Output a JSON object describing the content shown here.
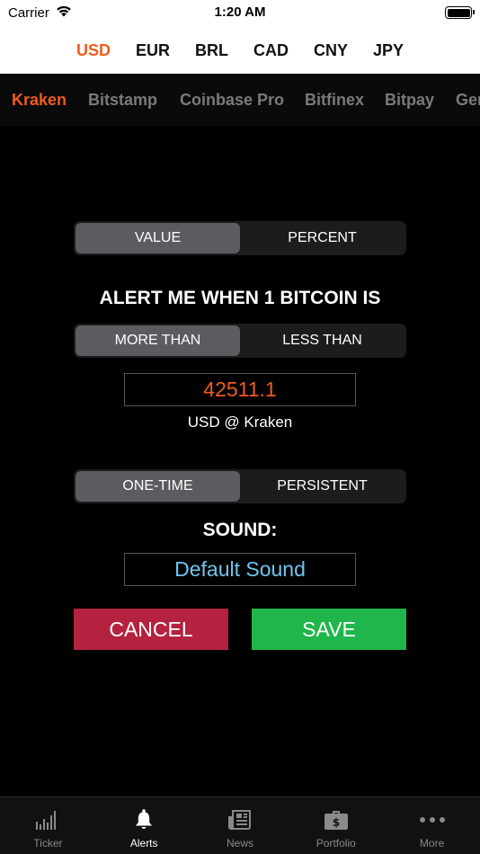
{
  "status_bar": {
    "carrier": "Carrier",
    "time": "1:20 AM"
  },
  "currencies": [
    {
      "label": "USD",
      "active": true
    },
    {
      "label": "EUR",
      "active": false
    },
    {
      "label": "BRL",
      "active": false
    },
    {
      "label": "CAD",
      "active": false
    },
    {
      "label": "CNY",
      "active": false
    },
    {
      "label": "JPY",
      "active": false
    }
  ],
  "exchanges": [
    {
      "label": "Kraken",
      "active": true
    },
    {
      "label": "Bitstamp",
      "active": false
    },
    {
      "label": "Coinbase Pro",
      "active": false
    },
    {
      "label": "Bitfinex",
      "active": false
    },
    {
      "label": "Bitpay",
      "active": false
    },
    {
      "label": "Gemini",
      "active": false
    }
  ],
  "alert": {
    "mode": {
      "options": [
        "VALUE",
        "PERCENT"
      ],
      "selected": 0
    },
    "heading": "ALERT ME WHEN 1 BITCOIN IS",
    "comparison": {
      "options": [
        "MORE THAN",
        "LESS THAN"
      ],
      "selected": 0
    },
    "value": "42511.1",
    "value_color": "#f05a1e",
    "value_context": "USD @ Kraken",
    "frequency": {
      "options": [
        "ONE-TIME",
        "PERSISTENT"
      ],
      "selected": 0
    },
    "sound_heading": "SOUND:",
    "sound": "Default Sound",
    "sound_color": "#6ec6f0"
  },
  "actions": {
    "cancel_label": "CANCEL",
    "save_label": "SAVE"
  },
  "tabs": [
    {
      "label": "Ticker",
      "icon": "bar-chart-icon",
      "active": false
    },
    {
      "label": "Alerts",
      "icon": "bell-icon",
      "active": true
    },
    {
      "label": "News",
      "icon": "newspaper-icon",
      "active": false
    },
    {
      "label": "Portfolio",
      "icon": "briefcase-icon",
      "active": false
    },
    {
      "label": "More",
      "icon": "more-dots-icon",
      "active": false
    }
  ],
  "colors": {
    "accent": "#f05a1e",
    "cancel": "#b5223f",
    "save": "#1fb64b"
  }
}
